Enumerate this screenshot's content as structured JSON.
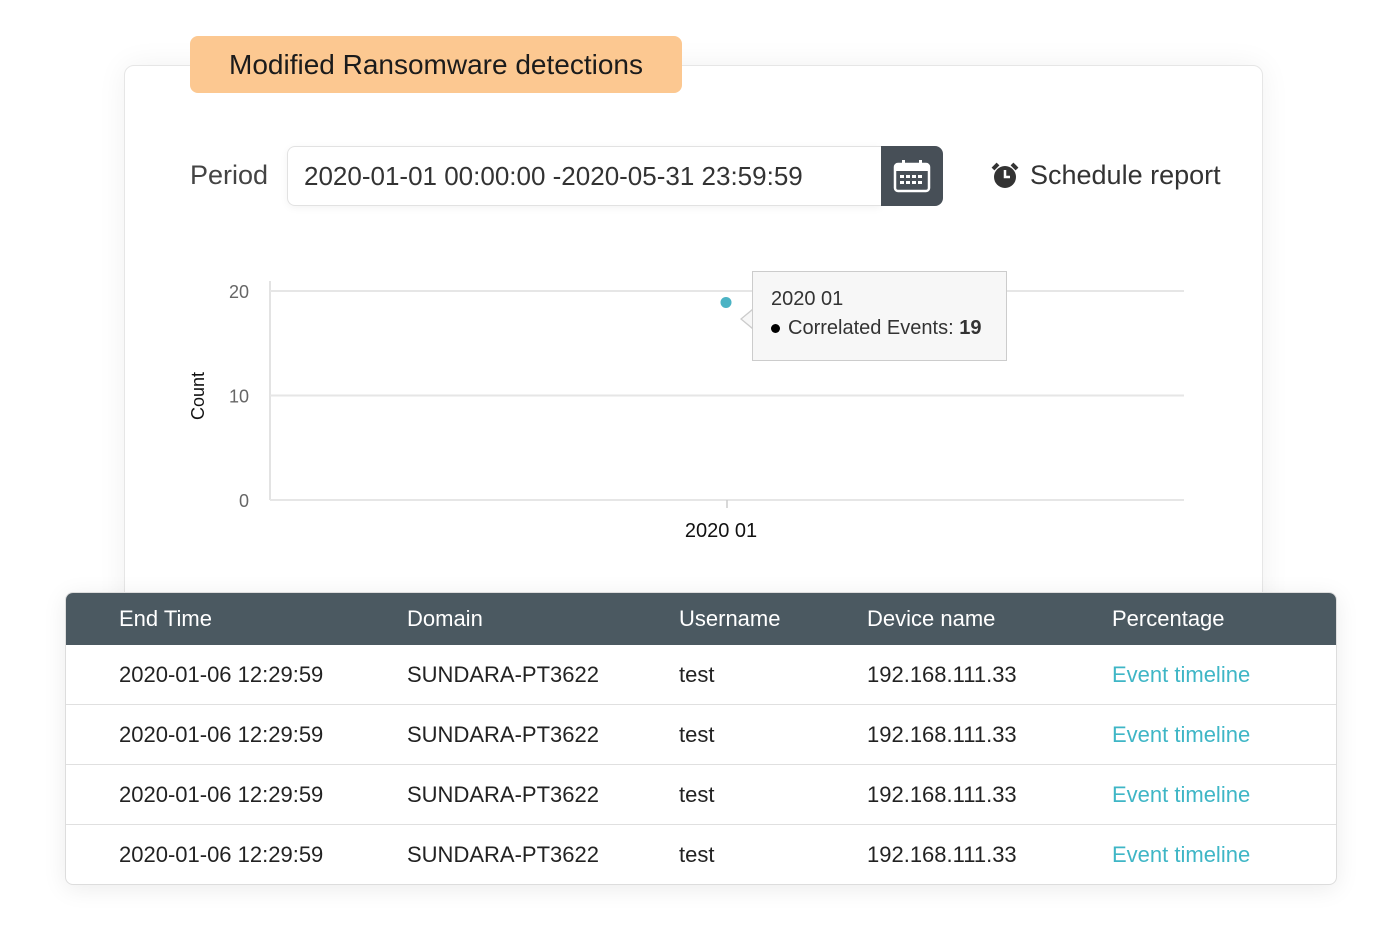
{
  "title": "Modified Ransomware detections",
  "period": {
    "label": "Period",
    "value": "2020-01-01 00:00:00 -2020-05-31 23:59:59"
  },
  "schedule_report": "Schedule report",
  "chart_data": {
    "type": "scatter",
    "ylabel": "Count",
    "xlabel": "",
    "categories": [
      "2020 01"
    ],
    "yticks": [
      "0",
      "10",
      "20"
    ],
    "ylim": [
      0,
      20
    ],
    "grid": true,
    "series": [
      {
        "name": "Correlated Events",
        "values": [
          19
        ],
        "color": "#4bb3c4"
      }
    ],
    "tooltip": {
      "title": "2020 01",
      "label": "Correlated Events:",
      "value": "19"
    }
  },
  "table": {
    "headers": [
      "End Time",
      "Domain",
      "Username",
      "Device name",
      "Percentage"
    ],
    "rows": [
      [
        "2020-01-06 12:29:59",
        "SUNDARA-PT3622",
        "test",
        "192.168.111.33",
        "Event timeline"
      ],
      [
        "2020-01-06 12:29:59",
        "SUNDARA-PT3622",
        "test",
        "192.168.111.33",
        "Event timeline"
      ],
      [
        "2020-01-06 12:29:59",
        "SUNDARA-PT3622",
        "test",
        "192.168.111.33",
        "Event timeline"
      ],
      [
        "2020-01-06 12:29:59",
        "SUNDARA-PT3622",
        "test",
        "192.168.111.33",
        "Event timeline"
      ]
    ]
  },
  "colors": {
    "header_bg": "#4b5961",
    "tag_bg": "#fcc891",
    "link": "#3fb6c6",
    "point": "#4bb3c4"
  }
}
